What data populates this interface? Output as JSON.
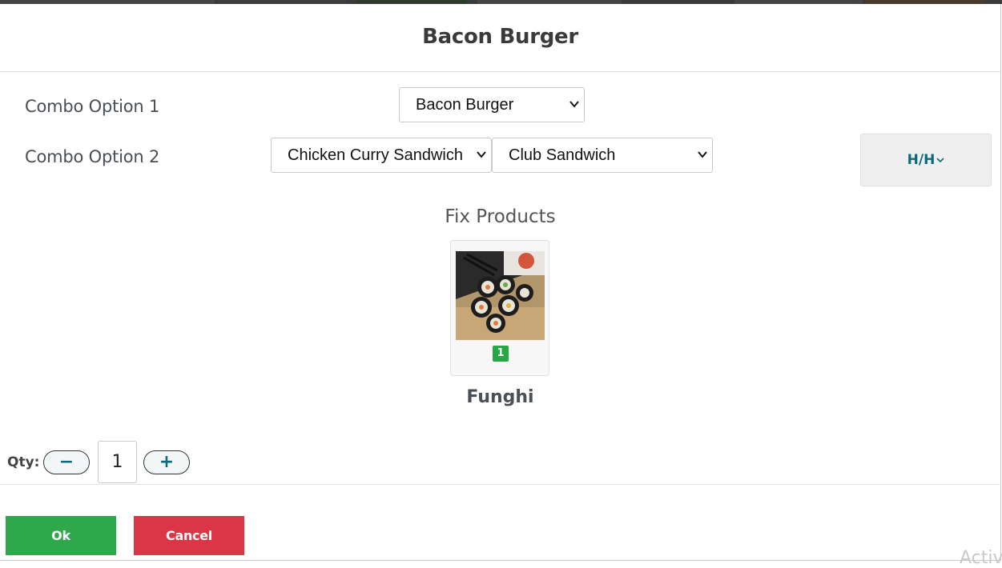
{
  "modal": {
    "title": "Bacon Burger"
  },
  "combo_options": [
    {
      "label": "Combo Option 1",
      "selects": [
        "Bacon Burger"
      ]
    },
    {
      "label": "Combo Option 2",
      "selects": [
        "Chicken Curry Sandwich",
        "Club Sandwich"
      ]
    }
  ],
  "hh_button": {
    "label": "H/H",
    "icon": "chevron-down-icon"
  },
  "fix_products": {
    "heading": "Fix Products",
    "items": [
      {
        "name": "Funghi",
        "count": "1",
        "image": "sushi-roll-photo"
      }
    ]
  },
  "quantity": {
    "label": "Qty:",
    "value": "1",
    "decrement": "−",
    "increment": "+"
  },
  "actions": {
    "ok_label": "Ok",
    "cancel_label": "Cancel"
  },
  "watermark": "Activ",
  "colors": {
    "accent": "#0b6b78",
    "ok": "#2ea84a",
    "cancel": "#dc3545",
    "badge": "#28a745"
  }
}
